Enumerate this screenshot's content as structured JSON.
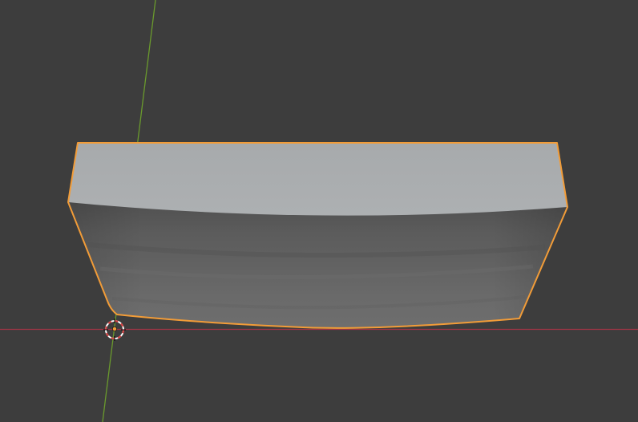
{
  "viewport": {
    "background": "#3d3d3d",
    "mode": "object-mode-3d-viewport"
  },
  "axes": {
    "x_axis_color": "#a33446",
    "y_axis_color": "#6a9a2d"
  },
  "selection": {
    "outline_color": "#f29c38",
    "object": "deformed-box-mesh"
  },
  "mesh_colors": {
    "top_face": "#a9acae",
    "front_face_top": "#5a5a5a",
    "front_face_bottom": "#6d6d6d"
  },
  "cursor": {
    "icon": "3d-cursor-icon",
    "ring_colors": [
      "#d94040",
      "#ffffff"
    ],
    "origin_color": "#f29c38"
  }
}
